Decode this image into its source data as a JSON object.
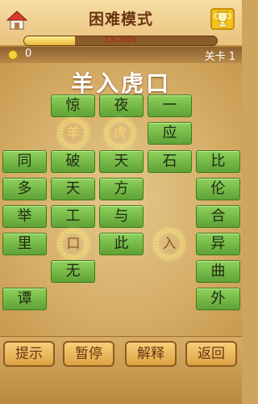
{
  "header": {
    "title": "困难模式",
    "progress_text": "53/200s",
    "progress_fraction": 0.265
  },
  "score": {
    "coins": "0",
    "level": "关卡 1"
  },
  "puzzle": {
    "idiom": "羊入虎口"
  },
  "grid": {
    "t_jing": "惊",
    "t_ye": "夜",
    "t_yi": "一",
    "t_ying": "应",
    "t_tong": "同",
    "t_po": "破",
    "t_tian": "天",
    "t_shi": "石",
    "t_bi": "比",
    "t_duo": "多",
    "t_tian2": "天",
    "t_fang": "方",
    "t_lun": "伦",
    "t_ju": "举",
    "t_gong": "工",
    "t_yu": "与",
    "t_he": "合",
    "t_li": "里",
    "t_ci": "此",
    "t_yi2": "异",
    "t_wu": "无",
    "t_qu": "曲",
    "t_tan": "谭",
    "t_wai": "外"
  },
  "slots": {
    "yang": "羊",
    "hu": "虎",
    "kou": "口",
    "ru": "入"
  },
  "buttons": {
    "hint": "提示",
    "pause": "暂停",
    "explain": "解释",
    "back": "返回"
  },
  "colors": {
    "tile": "#6fb843",
    "accent": "#f4c31c",
    "board": "#d6ae68"
  }
}
